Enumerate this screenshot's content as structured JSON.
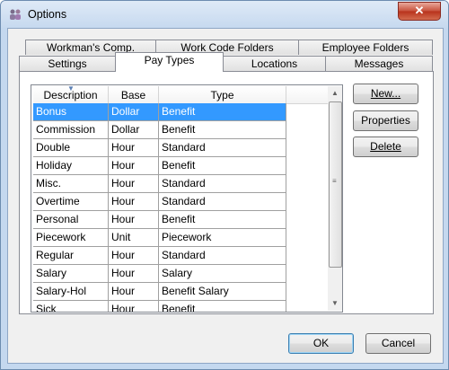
{
  "window": {
    "title": "Options",
    "close_glyph": "✕"
  },
  "tabs": {
    "row_back": [
      "Workman's Comp.",
      "Work Code Folders",
      "Employee Folders"
    ],
    "row_front": [
      "Settings",
      "Pay Types",
      "Locations",
      "Messages"
    ],
    "active": "Pay Types"
  },
  "grid": {
    "columns": [
      "Description",
      "Base",
      "Type"
    ],
    "rows": [
      [
        "Bonus",
        "Dollar",
        "Benefit"
      ],
      [
        "Commission",
        "Dollar",
        "Benefit"
      ],
      [
        "Double",
        "Hour",
        "Standard"
      ],
      [
        "Holiday",
        "Hour",
        "Benefit"
      ],
      [
        "Misc.",
        "Hour",
        "Standard"
      ],
      [
        "Overtime",
        "Hour",
        "Standard"
      ],
      [
        "Personal",
        "Hour",
        "Benefit"
      ],
      [
        "Piecework",
        "Unit",
        "Piecework"
      ],
      [
        "Regular",
        "Hour",
        "Standard"
      ],
      [
        "Salary",
        "Hour",
        "Salary"
      ],
      [
        "Salary-Hol",
        "Hour",
        "Benefit Salary"
      ],
      [
        "Sick",
        "Hour",
        "Benefit"
      ]
    ],
    "selected_index": 0
  },
  "buttons": {
    "new": "New...",
    "properties": "Properties",
    "delete": "Delete",
    "ok": "OK",
    "cancel": "Cancel"
  },
  "icons": {
    "app": "people-icon",
    "scroll_up": "▲",
    "scroll_down": "▼",
    "grip": "≡"
  }
}
